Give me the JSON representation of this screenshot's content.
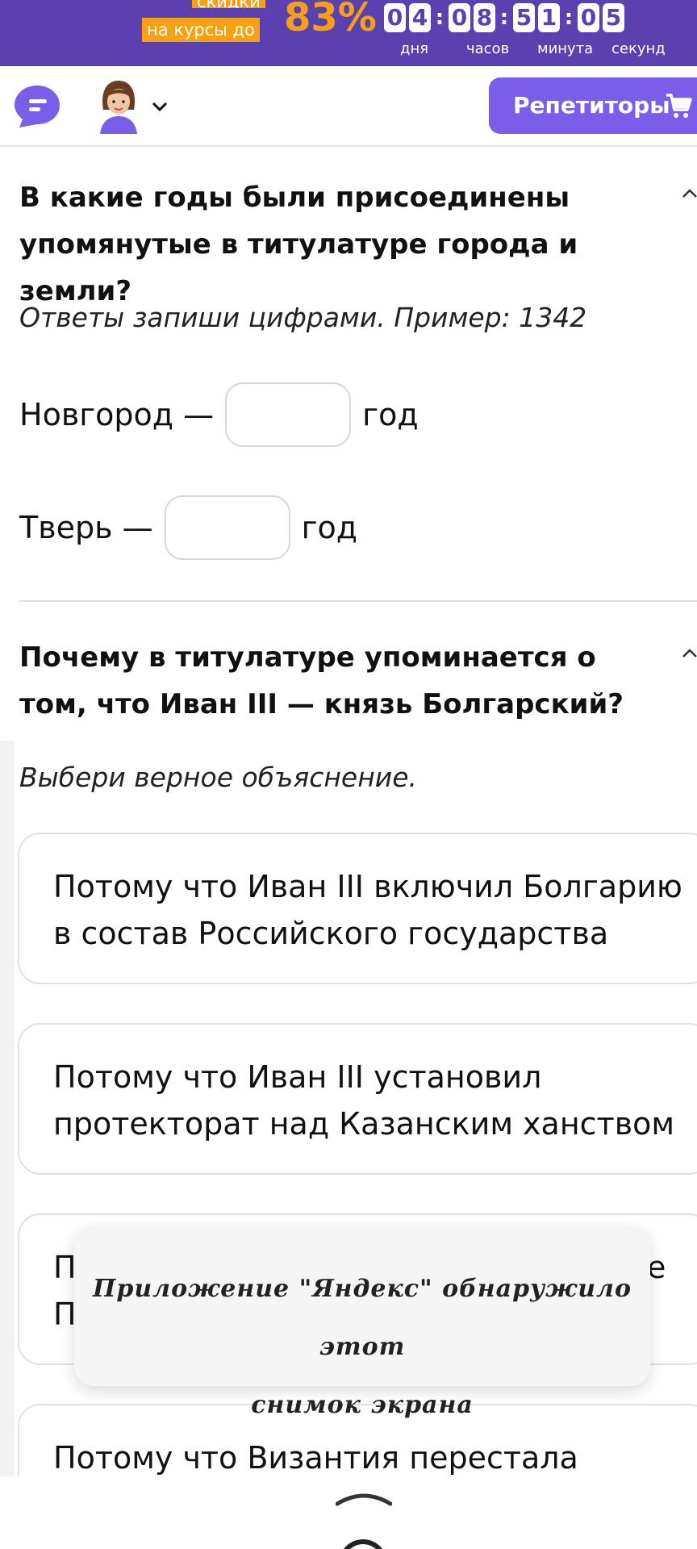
{
  "promo": {
    "tag_top": "скидки",
    "tag": "на курсы до",
    "percent": "83%",
    "timer_digits": [
      "0",
      "4",
      "0",
      "8",
      "5",
      "1",
      "0",
      "5"
    ],
    "timer_labels": [
      "дня",
      "часов",
      "минута",
      "секунд"
    ]
  },
  "header": {
    "tutors_label": "Репетиторы",
    "logo_icon": "chat-bubble-logo-icon",
    "cart_icon": "shopping-cart-icon",
    "avatar_icon": "user-avatar-icon",
    "chevron_icon": "chevron-down-icon"
  },
  "q1": {
    "question": "В какие годы были присоединены упомянутые в титулатуре города и земли?",
    "hint": "Ответы запиши цифрами. Пример: 1342",
    "rows": [
      {
        "prefix": "Новгород —",
        "value": "",
        "suffix": "год"
      },
      {
        "prefix": "Тверь —",
        "value": "",
        "suffix": "год"
      }
    ]
  },
  "q2": {
    "question": "Почему в титулатуре упоминается о том, что Иван III — князь Болгарский?",
    "hint": "Выбери верное объяснение.",
    "options": [
      "Потому что Иван III включил Болгарию в состав Российского государства",
      "Потому что Иван III установил протекторат над Казанским ханством",
      "П",
      "Потому что Византия перестала"
    ],
    "option3_line2": "П",
    "option3_tail": "е"
  },
  "toast": {
    "line1": "Приложение \"Яндекс\" обнаружило этот",
    "line2": "снимок экрана"
  },
  "colors": {
    "brand_purple": "#5b40b0",
    "button_purple": "#7a5de8",
    "accent_orange": "#f5a113"
  }
}
